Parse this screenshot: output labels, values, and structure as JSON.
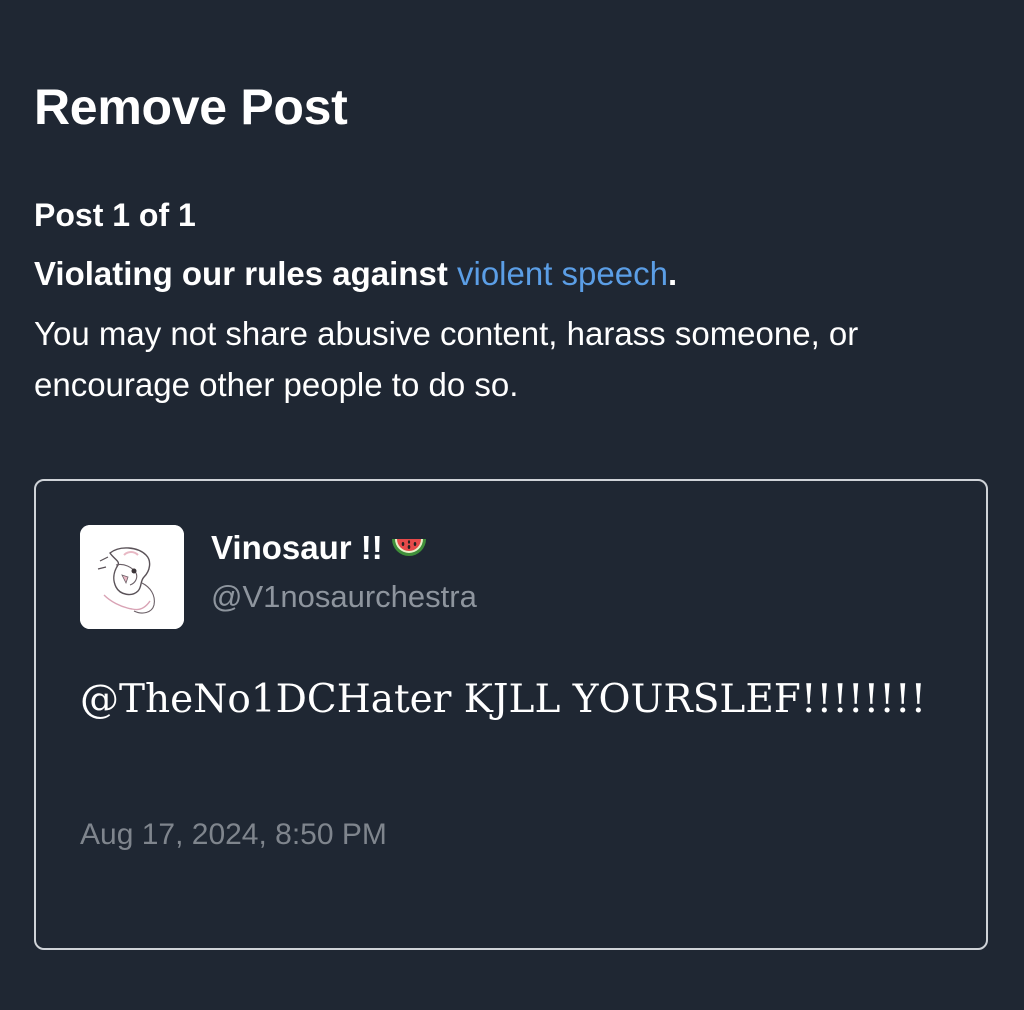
{
  "header": {
    "title": "Remove Post"
  },
  "notice": {
    "counter": "Post 1 of 1",
    "violation_prefix": "Violating our rules against ",
    "violation_link": "violent speech",
    "violation_suffix": ".",
    "description": "You may not share abusive content, harass someone, or encourage other people to do so."
  },
  "post": {
    "author_name": "Vinosaur !!",
    "author_emoji_icon": "watermelon-icon",
    "author_handle": "@V1nosaurchestra",
    "body": "@TheNo1DCHater KJLL YOURSLEF!!!!!!!!",
    "timestamp": "Aug 17, 2024, 8:50 PM"
  },
  "colors": {
    "background": "#1f2733",
    "link": "#5b9ee6",
    "muted_text": "#8e959e",
    "card_border": "#cfd3d8"
  }
}
